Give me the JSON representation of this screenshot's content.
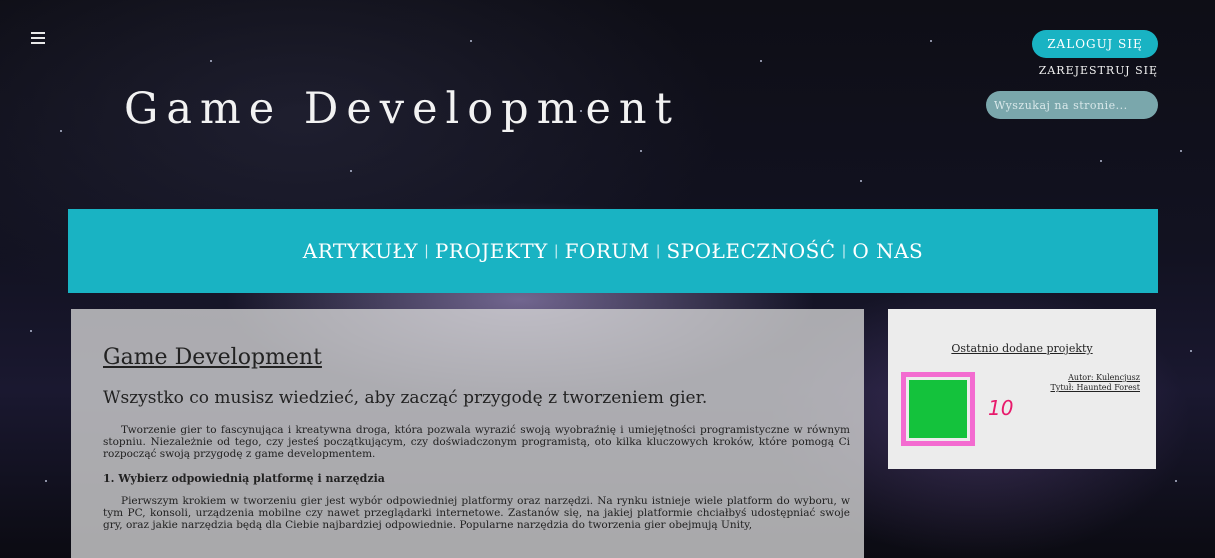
{
  "header": {
    "site_title": "Game Development",
    "login_label": "ZALOGUJ SIĘ",
    "register_label": "ZAREJESTRUJ SIĘ",
    "search_placeholder": "Wyszukaj na stronie..."
  },
  "nav": {
    "items": [
      "ARTYKUŁY",
      "PROJEKTY",
      "FORUM",
      "SPOŁECZNOŚĆ",
      "O NAS"
    ],
    "separator": "|"
  },
  "main": {
    "title": "Game Development",
    "subtitle": "Wszystko co musisz wiedzieć, aby zacząć przygodę z tworzeniem gier.",
    "intro": "Tworzenie gier to fascynująca i kreatywna droga, która pozwala wyrazić swoją wyobraźnię i umiejętności programistyczne w równym stopniu. Niezależnie od tego, czy jesteś początkującym, czy doświadczonym programistą, oto kilka kluczowych kroków, które pomogą Ci rozpocząć swoją przygodę z game developmentem.",
    "section1_title": "1. Wybierz odpowiednią platformę i narzędzia",
    "section1_text": "Pierwszym krokiem w tworzeniu gier jest wybór odpowiedniej platformy oraz narzędzi. Na rynku istnieje wiele platform do wyboru, w tym PC, konsoli, urządzenia mobilne czy nawet przeglądarki internetowe. Zastanów się, na jakiej platformie chciałbyś udostępniać swoje gry, oraz jakie narzędzia będą dla Ciebie najbardziej odpowiednie. Popularne narzędzia do tworzenia gier obejmują Unity,"
  },
  "sidebar": {
    "title": "Ostatnio dodane projekty",
    "author": "Autor: Kulencjusz",
    "project_title": "Tytuł: Haunted Forest",
    "thumb_color": "#14c23c",
    "highlight_color": "#f36bd0",
    "highlight_label": "10"
  },
  "colors": {
    "accent": "#19b3c3"
  },
  "icons": {
    "menu": "hamburger-menu-icon"
  }
}
